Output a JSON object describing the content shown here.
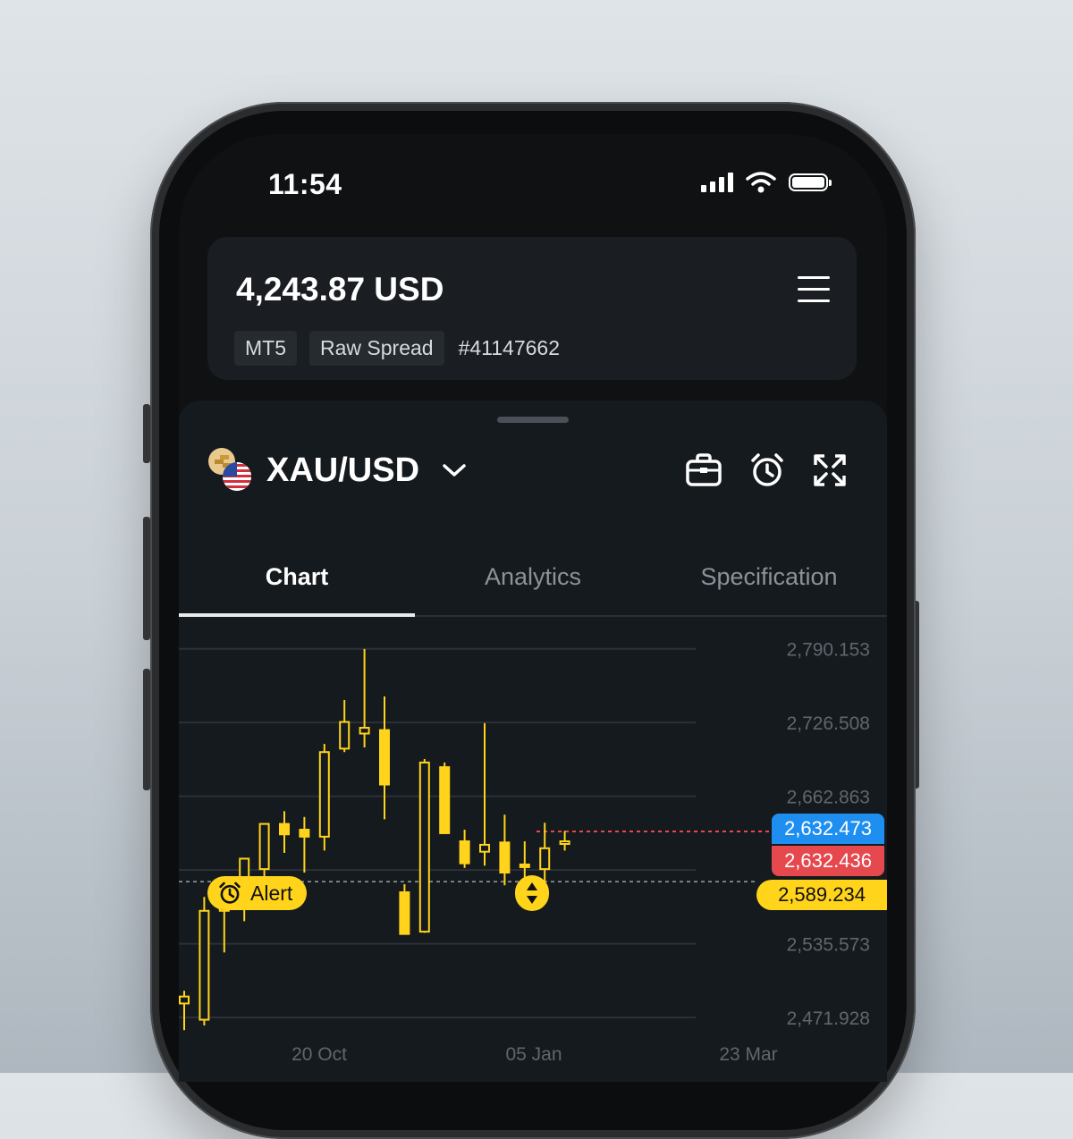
{
  "status": {
    "time": "11:54"
  },
  "account": {
    "balance": "4,243.87 USD",
    "platform": "MT5",
    "account_type": "Raw Spread",
    "account_number": "#41147662"
  },
  "instrument": {
    "symbol": "XAU/USD"
  },
  "tabs": [
    {
      "label": "Chart",
      "active": true
    },
    {
      "label": "Analytics",
      "active": false
    },
    {
      "label": "Specification",
      "active": false
    }
  ],
  "chart": {
    "alert_label": "Alert",
    "ask_price": "2,632.473",
    "bid_price": "2,632.436",
    "alert_price": "2,589.234",
    "colors": {
      "candle": "#ffd41a",
      "ask": "#1f8ef1",
      "bid": "#e5484d",
      "alert": "#ffd41a"
    }
  },
  "chart_data": {
    "type": "candlestick",
    "y_ticks": [
      "2,790.153",
      "2,726.508",
      "2,662.863",
      "2,535.573",
      "2,471.928"
    ],
    "x_ticks": [
      "20 Oct",
      "05 Jan",
      "23 Mar"
    ],
    "ylim": [
      2455,
      2810
    ],
    "candles": [
      {
        "o": 2484,
        "h": 2495,
        "l": 2461,
        "c": 2490
      },
      {
        "o": 2470,
        "h": 2576,
        "l": 2465,
        "c": 2564
      },
      {
        "o": 2564,
        "h": 2584,
        "l": 2528,
        "c": 2573
      },
      {
        "o": 2587,
        "h": 2608,
        "l": 2555,
        "c": 2609
      },
      {
        "o": 2600,
        "h": 2636,
        "l": 2589,
        "c": 2639
      },
      {
        "o": 2639,
        "h": 2650,
        "l": 2614,
        "c": 2630
      },
      {
        "o": 2634,
        "h": 2645,
        "l": 2597,
        "c": 2628
      },
      {
        "o": 2628,
        "h": 2708,
        "l": 2616,
        "c": 2701
      },
      {
        "o": 2704,
        "h": 2746,
        "l": 2701,
        "c": 2727
      },
      {
        "o": 2717,
        "h": 2790,
        "l": 2705,
        "c": 2722
      },
      {
        "o": 2720,
        "h": 2749,
        "l": 2643,
        "c": 2673
      },
      {
        "o": 2580,
        "h": 2587,
        "l": 2545,
        "c": 2544
      },
      {
        "o": 2546,
        "h": 2695,
        "l": 2545,
        "c": 2692
      },
      {
        "o": 2688,
        "h": 2692,
        "l": 2639,
        "c": 2631
      },
      {
        "o": 2624,
        "h": 2634,
        "l": 2601,
        "c": 2605
      },
      {
        "o": 2615,
        "h": 2726,
        "l": 2603,
        "c": 2621
      },
      {
        "o": 2623,
        "h": 2647,
        "l": 2586,
        "c": 2597
      },
      {
        "o": 2604,
        "h": 2624,
        "l": 2590,
        "c": 2602
      },
      {
        "o": 2600,
        "h": 2640,
        "l": 2585,
        "c": 2618
      },
      {
        "o": 2624,
        "h": 2633,
        "l": 2616,
        "c": 2624
      }
    ]
  }
}
